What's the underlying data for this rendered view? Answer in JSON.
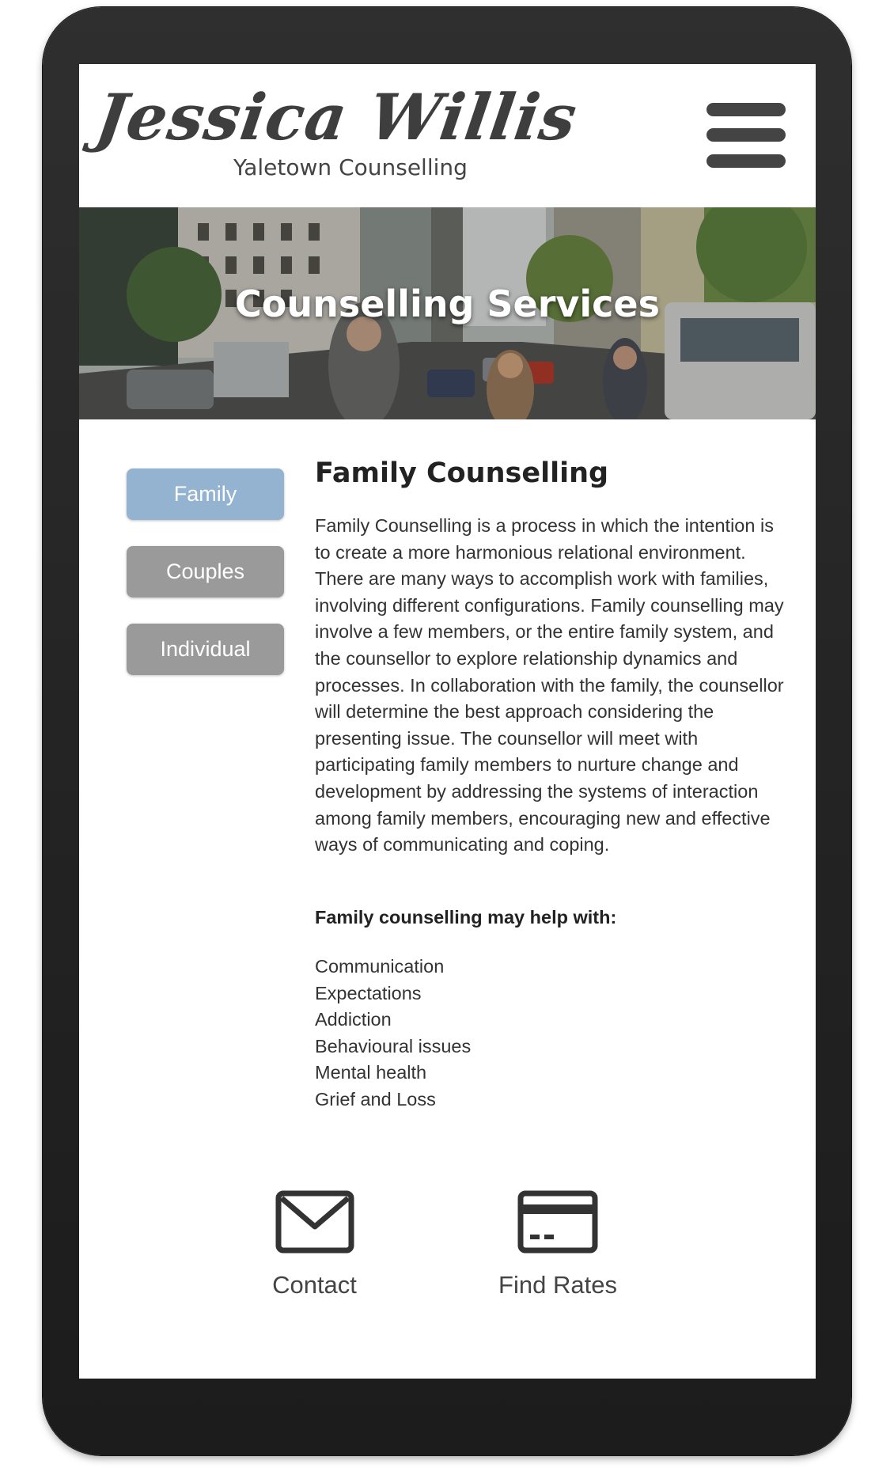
{
  "header": {
    "brand_name": "Jessica Willis",
    "brand_subtitle": "Yaletown Counselling",
    "menu_icon": "hamburger-menu-icon"
  },
  "hero": {
    "title": "Counselling Services"
  },
  "tabs": [
    {
      "label": "Family",
      "active": true
    },
    {
      "label": "Couples",
      "active": false
    },
    {
      "label": "Individual",
      "active": false
    }
  ],
  "content": {
    "title": "Family Counselling",
    "body": "Family Counselling is a process in which the intention is to create a more harmonious relational environment.  There are many ways to accomplish work with families, involving different configurations. Family counselling may involve a few members, or the entire family system, and the counsellor to explore relationship dynamics and processes. In collaboration with the family, the counsellor will determine the best approach considering the presenting issue.  The counsellor will meet with participating family members to nurture change and development by addressing the systems of interaction among family members, encouraging new and effective ways of communicating and coping.",
    "help_heading": "Family counselling may help with:",
    "help_items": [
      "Communication",
      "Expectations",
      "Addiction",
      "Behavioural issues",
      "Mental health",
      "Grief and Loss"
    ]
  },
  "actions": {
    "contact": {
      "label": "Contact",
      "icon": "envelope-icon"
    },
    "rates": {
      "label": "Find Rates",
      "icon": "credit-card-icon"
    }
  },
  "colors": {
    "active_tab": "#94b3d1",
    "inactive_tab": "#9a9a9a",
    "text": "#333333",
    "device_frame": "#262626"
  }
}
